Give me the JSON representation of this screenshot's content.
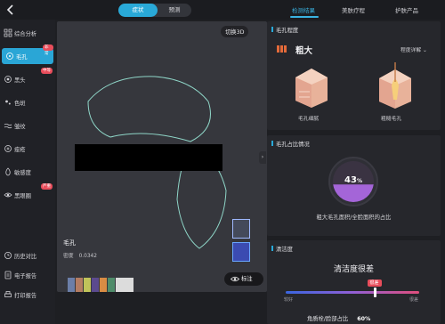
{
  "header": {
    "modes": [
      "症状",
      "预测"
    ],
    "active_mode": "症状",
    "tabs": [
      "检测结果",
      "美肤疗程",
      "护肤产品"
    ],
    "active_tab": "检测结果"
  },
  "sidebar": {
    "items": [
      {
        "label": "综合分析",
        "icon": "grid-icon"
      },
      {
        "label": "毛孔",
        "icon": "pore-icon",
        "badge": "非常",
        "active": true
      },
      {
        "label": "黑头",
        "icon": "blackhead-icon",
        "badge": "中等"
      },
      {
        "label": "色斑",
        "icon": "spot-icon"
      },
      {
        "label": "皱纹",
        "icon": "wrinkle-icon"
      },
      {
        "label": "痤疮",
        "icon": "acne-icon"
      },
      {
        "label": "敏感度",
        "icon": "sensitivity-icon"
      },
      {
        "label": "黑眼圈",
        "icon": "dark-circle-icon",
        "badge": "严重"
      }
    ],
    "bottom_items": [
      {
        "label": "历史对比",
        "icon": "history-icon"
      },
      {
        "label": "电子报告",
        "icon": "report-icon"
      },
      {
        "label": "打印报告",
        "icon": "print-icon"
      }
    ]
  },
  "photo_panel": {
    "switch_3d_label": "切换3D",
    "overlay_title": "毛孔",
    "density_label": "密度",
    "density_value": "0.0342",
    "mark_label": "标注"
  },
  "pore_level_card": {
    "title": "毛孔程度",
    "level": "粗大",
    "level_bars": 3,
    "detail_label": "程度详解",
    "images": [
      {
        "label": "毛孔细腻",
        "icon": "fine-pore-skin-icon"
      },
      {
        "label": "粗糙毛孔",
        "icon": "coarse-pore-skin-icon"
      }
    ]
  },
  "pore_ratio_card": {
    "title": "毛孔占比情况",
    "value": 43,
    "unit": "%",
    "caption": "粗大毛孔面积/全脸面积的占比"
  },
  "cleanliness_card": {
    "title": "清洁度",
    "level_text": "清洁度很差",
    "scale_min": "较好",
    "scale_max": "很差",
    "indicator_badge": "很差",
    "indicator_position": 0.67,
    "ratio_label": "角质栓/脸部占比",
    "ratio_value": "60%"
  },
  "colors": {
    "accent": "#29a9d8",
    "badge": "#e84d5b",
    "level": "#e36a3a",
    "ring": "#a465d8"
  }
}
